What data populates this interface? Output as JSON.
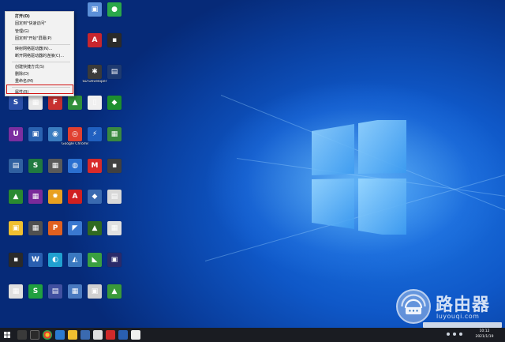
{
  "context_menu": {
    "items": [
      {
        "label": "打开(O)",
        "bold": true
      },
      {
        "label": "固定到\"快速访问\""
      },
      {
        "label": "管理(G)"
      },
      {
        "label": "固定到\"开始\"屏幕(P)"
      },
      {
        "sep": true
      },
      {
        "label": "映射网络驱动器(N)..."
      },
      {
        "label": "断开网络驱动器的连接(C)..."
      },
      {
        "sep": true
      },
      {
        "label": "创建快捷方式(S)"
      },
      {
        "label": "删除(D)"
      },
      {
        "label": "重命名(M)"
      },
      {
        "sep": true
      },
      {
        "label": "属性(R)",
        "highlighted": true
      }
    ]
  },
  "desktop_icons": [
    {
      "label": "",
      "color": "#5b8fd8",
      "glyph": "▣"
    },
    {
      "label": "",
      "color": "#2aa84a",
      "glyph": "●"
    },
    {
      "label": "",
      "color": "#c8262e",
      "glyph": "A"
    },
    {
      "label": "",
      "color": "#2a2a2a",
      "glyph": "▪"
    },
    {
      "label": "SD Developer",
      "color": "#3a3a3a",
      "glyph": "✱"
    },
    {
      "label": "",
      "color": "#1e3a70",
      "glyph": "▤"
    },
    {
      "label": "",
      "color": "#2b4fa8",
      "glyph": "S"
    },
    {
      "label": "",
      "color": "#e8e8e8",
      "glyph": "▦"
    },
    {
      "label": "",
      "color": "#c83030",
      "glyph": "F"
    },
    {
      "label": "",
      "color": "#2f8f3a",
      "glyph": "▲"
    },
    {
      "label": "",
      "color": "#f0f0f0",
      "glyph": "▯"
    },
    {
      "label": "",
      "color": "#1d8f2e",
      "glyph": "◆"
    },
    {
      "label": "",
      "color": "#7b2fa0",
      "glyph": "U"
    },
    {
      "label": "",
      "color": "#2a62b0",
      "glyph": "▣"
    },
    {
      "label": "",
      "color": "#3a7dc0",
      "glyph": "◉"
    },
    {
      "label": "Google Chrome",
      "color": "#e04030",
      "glyph": "◎"
    },
    {
      "label": "",
      "color": "#2060c0",
      "glyph": "⚡"
    },
    {
      "label": "",
      "color": "#3a8a40",
      "glyph": "▦"
    },
    {
      "label": "",
      "color": "#3060a0",
      "glyph": "▤"
    },
    {
      "label": "",
      "color": "#207a40",
      "glyph": "S"
    },
    {
      "label": "",
      "color": "#5a5a5a",
      "glyph": "▦"
    },
    {
      "label": "",
      "color": "#2a6fd0",
      "glyph": "◍"
    },
    {
      "label": "",
      "color": "#d82a2a",
      "glyph": "M"
    },
    {
      "label": "",
      "color": "#404040",
      "glyph": "▪"
    },
    {
      "label": "",
      "color": "#2a8a30",
      "glyph": "▲"
    },
    {
      "label": "",
      "color": "#7a2a9a",
      "glyph": "▦"
    },
    {
      "label": "",
      "color": "#e8a020",
      "glyph": "✹"
    },
    {
      "label": "",
      "color": "#d02020",
      "glyph": "A"
    },
    {
      "label": "",
      "color": "#3a6ab0",
      "glyph": "◆"
    },
    {
      "label": "",
      "color": "#d8d8d8",
      "glyph": "▤"
    },
    {
      "label": "",
      "color": "#f0c030",
      "glyph": "▣"
    },
    {
      "label": "",
      "color": "#505050",
      "glyph": "▦"
    },
    {
      "label": "",
      "color": "#e06020",
      "glyph": "P"
    },
    {
      "label": "",
      "color": "#3a78d0",
      "glyph": "◤"
    },
    {
      "label": "",
      "color": "#306a20",
      "glyph": "▲"
    },
    {
      "label": "",
      "color": "#e0e0e0",
      "glyph": "▦"
    },
    {
      "label": "",
      "color": "#2a2a2a",
      "glyph": "▪"
    },
    {
      "label": "",
      "color": "#2a5fb0",
      "glyph": "W"
    },
    {
      "label": "",
      "color": "#20a0d0",
      "glyph": "◐"
    },
    {
      "label": "",
      "color": "#3a78c0",
      "glyph": "◭"
    },
    {
      "label": "",
      "color": "#3aa040",
      "glyph": "◣"
    },
    {
      "label": "",
      "color": "#2a2a6a",
      "glyph": "▣"
    },
    {
      "label": "",
      "color": "#e0e0e0",
      "glyph": "▦"
    },
    {
      "label": "",
      "color": "#20a040",
      "glyph": "S"
    },
    {
      "label": "",
      "color": "#4050a0",
      "glyph": "▤"
    },
    {
      "label": "",
      "color": "#4a7ac0",
      "glyph": "▦"
    },
    {
      "label": "",
      "color": "#d0d0d0",
      "glyph": "▣"
    },
    {
      "label": "",
      "color": "#3a9a3a",
      "glyph": "▲"
    },
    {
      "label": "",
      "color": "#303030",
      "glyph": "▤"
    },
    {
      "label": "",
      "color": "#f0f0f0",
      "glyph": "▯"
    },
    {
      "label": "",
      "color": "#e0e8f0",
      "glyph": "◍"
    },
    {
      "label": "",
      "color": "#d04020",
      "glyph": "◆"
    },
    {
      "label": "",
      "color": "#3a6a9a",
      "glyph": "▣"
    },
    {
      "label": "",
      "color": "#b03030",
      "glyph": "▲"
    },
    {
      "label": "",
      "color": "#404040",
      "glyph": "▦"
    }
  ],
  "watermark": {
    "title": "路由器",
    "subtitle": "luyouqi.com"
  },
  "taskbar": {
    "time": "10:12",
    "date": "2021/1/19"
  }
}
